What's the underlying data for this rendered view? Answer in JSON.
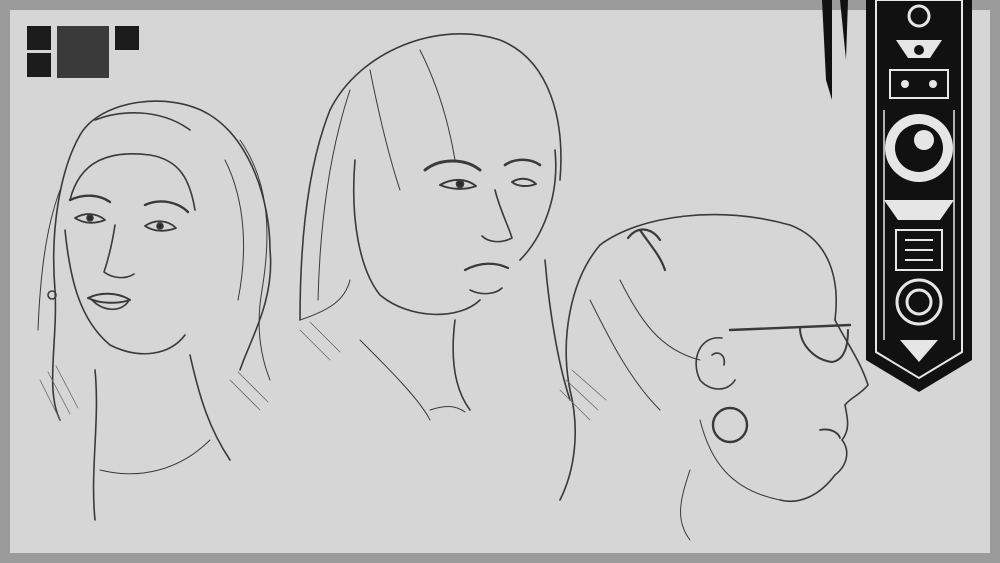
{
  "artwork": {
    "subject": "sketch-sheet",
    "palette": {
      "frame": "#9b9b9b",
      "paper": "#d6d6d6",
      "ink": "#2b2b2b",
      "banner": "#111111"
    },
    "icons": [
      "logo-blocks-icon",
      "ornamental-banner-icon"
    ]
  }
}
